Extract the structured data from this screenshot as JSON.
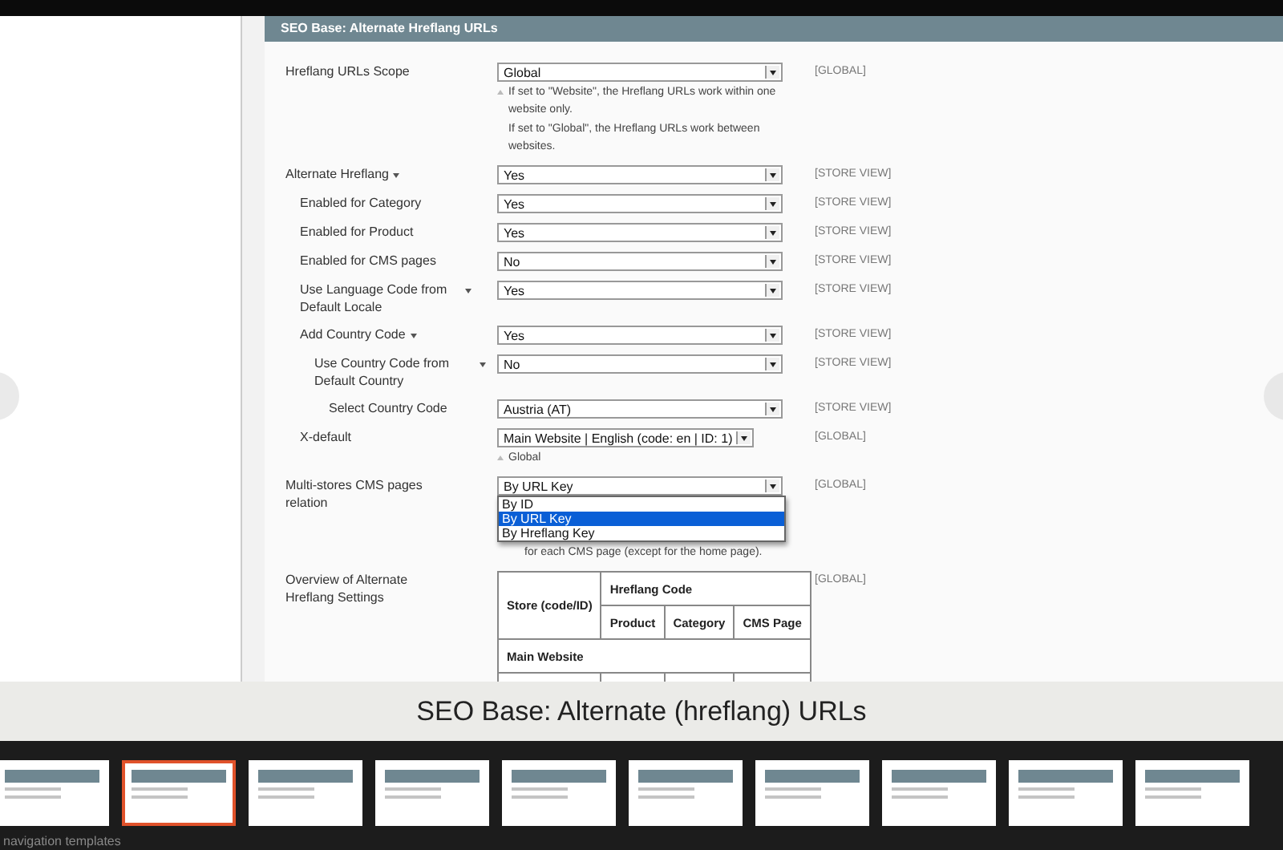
{
  "section": {
    "title": "SEO Base: Alternate Hreflang URLs"
  },
  "fields": [
    {
      "kind": "select",
      "label": "Hreflang URLs Scope",
      "value": "Global",
      "scope": "[GLOBAL]",
      "notes": [
        "If set to \"Website\", the Hreflang URLs work within one website only.",
        "If set to \"Global\", the Hreflang URLs work between websites."
      ]
    },
    {
      "kind": "select",
      "label": "Alternate Hreflang",
      "expanded": true,
      "value": "Yes",
      "scope": "[STORE VIEW]",
      "children": [
        {
          "kind": "select",
          "label": "Enabled for Category",
          "value": "Yes",
          "scope": "[STORE VIEW]"
        },
        {
          "kind": "select",
          "label": "Enabled for Product",
          "value": "Yes",
          "scope": "[STORE VIEW]"
        },
        {
          "kind": "select",
          "label": "Enabled for CMS pages",
          "value": "No",
          "scope": "[STORE VIEW]"
        },
        {
          "kind": "select",
          "label": "Use Language Code from Default Locale",
          "expanded": true,
          "value": "Yes",
          "scope": "[STORE VIEW]"
        },
        {
          "kind": "select",
          "label": "Add Country Code",
          "expanded": true,
          "value": "Yes",
          "scope": "[STORE VIEW]",
          "children": [
            {
              "kind": "select",
              "label": "Use Country Code from Default Country",
              "expanded": true,
              "value": "No",
              "scope": "[STORE VIEW]",
              "children": [
                {
                  "kind": "select",
                  "label": "Select Country Code",
                  "value": "Austria (AT)",
                  "scope": "[STORE VIEW]"
                }
              ]
            }
          ]
        },
        {
          "kind": "compact_select",
          "label": "X-default",
          "value": "Main Website | English (code: en | ID: 1)",
          "scope": "[GLOBAL]",
          "notes": [
            "Global"
          ]
        }
      ]
    },
    {
      "kind": "open_select",
      "label": "Multi-stores CMS pages relation",
      "value": "By URL Key",
      "scope": "[GLOBAL]",
      "options": [
        {
          "label": "By ID",
          "selected": false
        },
        {
          "label": "By URL Key",
          "selected": true
        },
        {
          "label": "By Hreflang Key",
          "selected": false
        }
      ],
      "notes": [
        "for each CMS page (except for the home page)."
      ]
    },
    {
      "kind": "table",
      "label": "Overview of Alternate Hreflang Settings",
      "scope": "[GLOBAL]",
      "table": {
        "store_heading": "Store (code/ID)",
        "code_heading": "Hreflang Code",
        "columns": [
          "Product",
          "Category",
          "CMS Page"
        ],
        "group": "Main Website"
      }
    }
  ],
  "caption": "SEO Base: Alternate (hreflang) URLs",
  "thumbnails": [
    {
      "selected": false
    },
    {
      "selected": true
    },
    {
      "selected": false
    },
    {
      "selected": false
    },
    {
      "selected": false
    },
    {
      "selected": false
    },
    {
      "selected": false
    },
    {
      "selected": false
    },
    {
      "selected": false
    },
    {
      "selected": false
    }
  ],
  "footer_text": "navigation templates"
}
